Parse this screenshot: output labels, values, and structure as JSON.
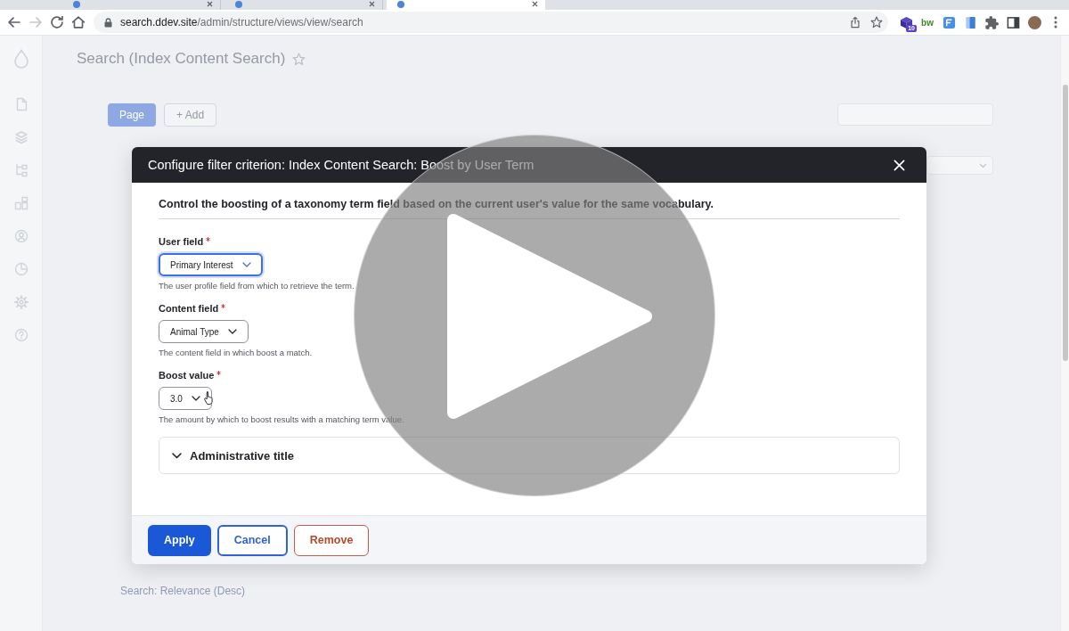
{
  "browser": {
    "tabs": [
      {
        "selected": false
      },
      {
        "selected": false
      },
      {
        "selected": true
      }
    ],
    "nav_buttons": [
      {
        "kind": "back",
        "disabled": false
      },
      {
        "kind": "forward",
        "disabled": true
      },
      {
        "kind": "reload",
        "disabled": false
      },
      {
        "kind": "home",
        "disabled": false
      }
    ],
    "url": {
      "domain": "search.ddev.site",
      "path": "/admin/structure/views/view/search"
    },
    "extensions": [
      {
        "kind": "stack",
        "badge": "10"
      },
      {
        "kind": "text",
        "label": "bw"
      },
      {
        "kind": "doc"
      },
      {
        "kind": "book"
      },
      {
        "kind": "puzzle"
      },
      {
        "kind": "sidebar"
      },
      {
        "kind": "avatar"
      }
    ]
  },
  "page": {
    "title": "Search (Index Content Search)",
    "buttons": [
      {
        "label": "Page",
        "kind": "primary"
      },
      {
        "label": "+ Add",
        "kind": "secondary"
      }
    ],
    "sort_item": "Search: Relevance (Desc)"
  },
  "dialog": {
    "title": "Configure filter criterion: Index Content Search: Boost by User Term",
    "description": "Control the boosting of a taxonomy term field based on the current user's value for the same vocabulary.",
    "fields": [
      {
        "label": "User field",
        "required": true,
        "value": "Primary Interest",
        "focused": true,
        "help": "The user profile field from which to retrieve the term."
      },
      {
        "label": "Content field",
        "required": true,
        "value": "Animal Type",
        "focused": false,
        "help": "The content field in which boost a match."
      },
      {
        "label": "Boost value",
        "required": true,
        "value": "3.0",
        "focused": false,
        "help": "The amount by which to boost results with a matching term value."
      }
    ],
    "details": {
      "summary": "Administrative title",
      "expanded": false
    },
    "buttons": [
      {
        "label": "Apply",
        "kind": "primary"
      },
      {
        "label": "Cancel",
        "kind": "secondary"
      },
      {
        "label": "Remove",
        "kind": "danger"
      }
    ]
  }
}
